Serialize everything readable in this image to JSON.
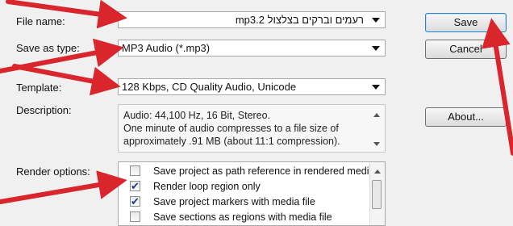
{
  "labels": {
    "file_name": "File name:",
    "save_as_type": "Save as type:",
    "template": "Template:",
    "description": "Description:",
    "render_options": "Render options:"
  },
  "fields": {
    "file_name_value": "רעמים וברקים בצלצול 2.mp3",
    "save_as_type_value": "MP3 Audio (*.mp3)",
    "template_value": "128 Kbps, CD Quality Audio, Unicode"
  },
  "description_lines": [
    "Audio: 44,100 Hz, 16 Bit, Stereo.",
    "One minute of audio compresses to a file size of",
    "approximately .91 MB (about 11:1 compression)."
  ],
  "buttons": {
    "save": "Save",
    "cancel": "Cancel",
    "about": "About..."
  },
  "render_options": [
    {
      "label": "Save project as path reference in rendered media",
      "checked": false
    },
    {
      "label": "Render loop region only",
      "checked": true
    },
    {
      "label": "Save project markers with media file",
      "checked": true
    },
    {
      "label": "Save sections as regions with media file",
      "checked": false
    }
  ],
  "colors": {
    "annotation_arrow": "#d9252c",
    "dialog_bg": "#f0f0f0",
    "default_button_border": "#3c7fb1"
  }
}
